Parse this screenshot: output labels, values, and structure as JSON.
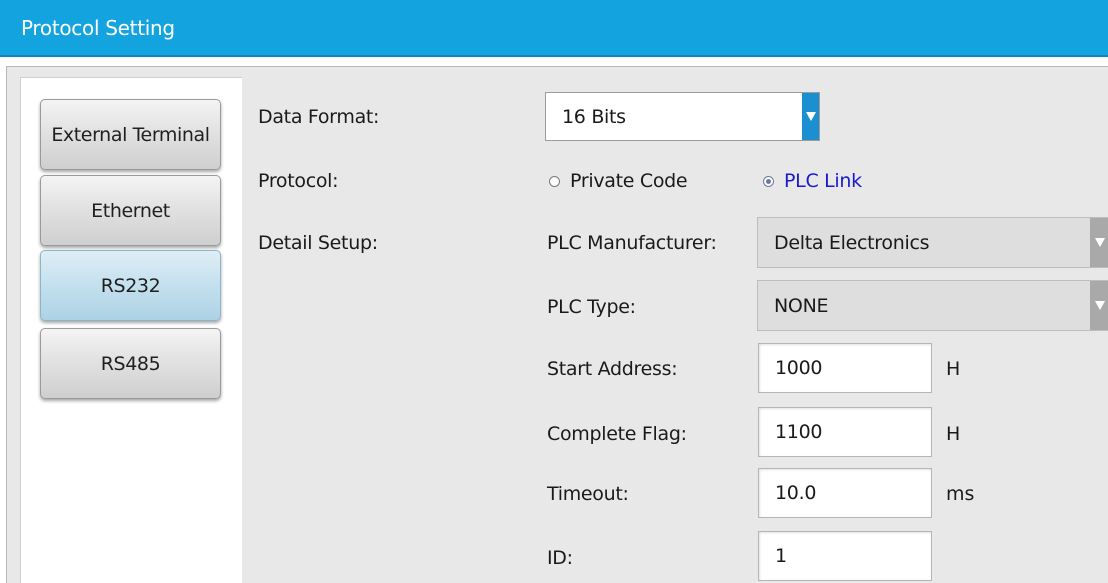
{
  "window": {
    "title": "Protocol Setting"
  },
  "nav": {
    "items": [
      {
        "label": "External Terminal",
        "active": false
      },
      {
        "label": "Ethernet",
        "active": false
      },
      {
        "label": "RS232",
        "active": true
      },
      {
        "label": "RS485",
        "active": false
      }
    ]
  },
  "form": {
    "data_format": {
      "label": "Data Format:",
      "value": "16 Bits"
    },
    "protocol": {
      "label": "Protocol:",
      "options": [
        {
          "label": "Private Code",
          "selected": false
        },
        {
          "label": "PLC Link",
          "selected": true
        }
      ]
    },
    "detail_setup": {
      "label": "Detail Setup:"
    },
    "plc_manufacturer": {
      "label": "PLC Manufacturer:",
      "value": "Delta Electronics"
    },
    "plc_type": {
      "label": "PLC Type:",
      "value": "NONE"
    },
    "start_address": {
      "label": "Start Address:",
      "value": "1000",
      "unit": "H"
    },
    "complete_flag": {
      "label": "Complete Flag:",
      "value": "1100",
      "unit": "H"
    },
    "timeout": {
      "label": "Timeout:",
      "value": "10.0",
      "unit": "ms"
    },
    "id": {
      "label": "ID:",
      "value": "1"
    }
  },
  "colors": {
    "titlebar": "#13a3df",
    "active_tab": "#c4e0ee",
    "selected_radio_text": "#1a1acc",
    "dropdown_arrow": "#1b8fd0"
  }
}
